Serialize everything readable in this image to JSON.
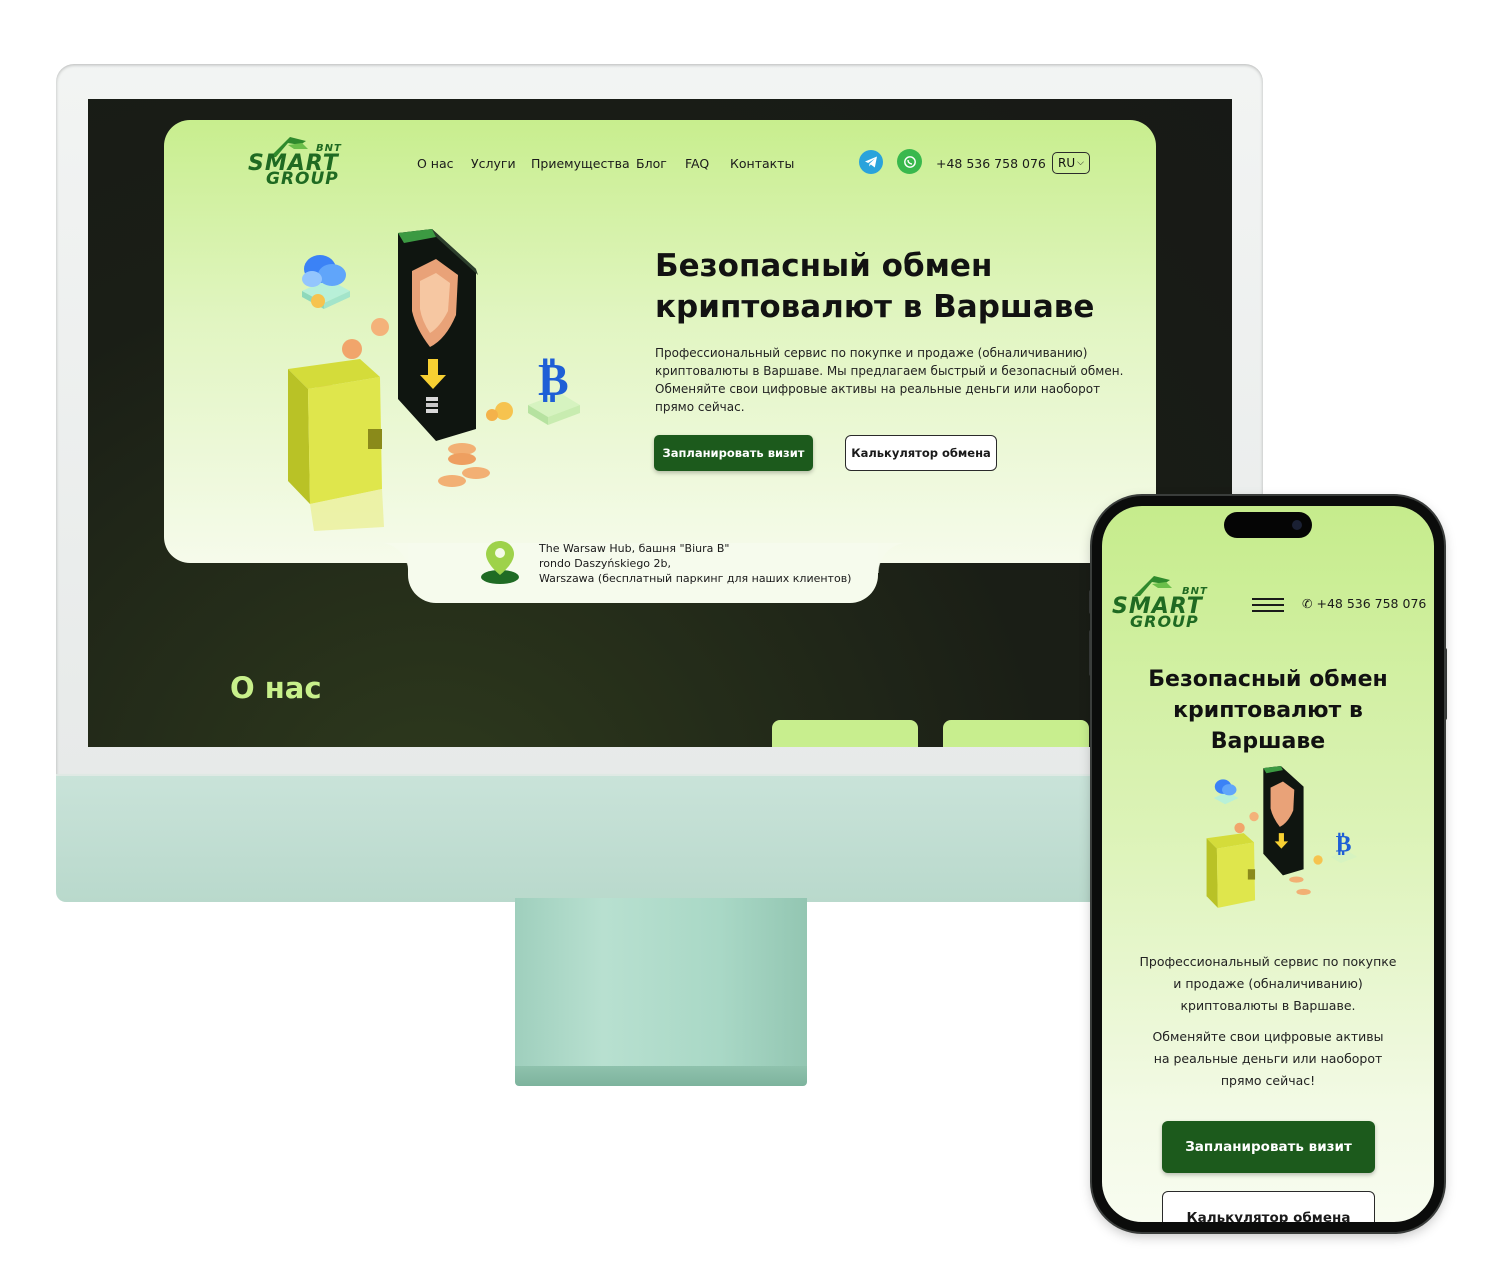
{
  "brand": {
    "logo_main": "SMART",
    "logo_sub": "GROUP",
    "logo_badge": "BNT",
    "accent_green": "#1c5a1c",
    "light_green": "#c8ee8e"
  },
  "desktop": {
    "nav": {
      "items": [
        "О нас",
        "Услуги",
        "Приемущества",
        "Блог",
        "FAQ",
        "Контакты"
      ],
      "telegram_icon": "telegram-icon",
      "whatsapp_icon": "whatsapp-icon",
      "phone": "+48 536 758 076",
      "language": "RU"
    },
    "hero": {
      "title_line1": "Безопасный обмен",
      "title_line2": "криптовалют в Варшаве",
      "description": "Профессиональный сервис по покупке и продаже (обналичиванию) криптовалюты в Варшаве. Мы предлагаем быстрый и безопасный обмен. Обменяйте свои цифровые активы на реальные деньги или наоборот прямо сейчас.",
      "primary_button": "Запланировать визит",
      "secondary_button": "Калькулятор обмена"
    },
    "address": {
      "line1": "The Warsaw Hub, башня \"Biura B\"",
      "line2": "rondo Daszyńskiego 2b,",
      "line3": "Warszawa (бесплатный паркинг для наших клиентов)"
    },
    "about_heading": "О нас"
  },
  "mobile": {
    "phone": "+48 536 758 076",
    "menu_icon": "hamburger-menu-icon",
    "title_line1": "Безопасный обмен",
    "title_line2": "криптовалют в",
    "title_line3": "Варшаве",
    "desc1_line1": "Профессиональный сервис по покупке",
    "desc1_line2": "и продаже (обналичиванию)",
    "desc1_line3": "криптовалюты в Варшаве.",
    "desc2_line1": "Обменяйте свои цифровые активы",
    "desc2_line2": "на реальные деньги или наоборот",
    "desc2_line3": "прямо сейчас!",
    "primary_button": "Запланировать визит",
    "secondary_button": "Калькулятор обмена"
  }
}
